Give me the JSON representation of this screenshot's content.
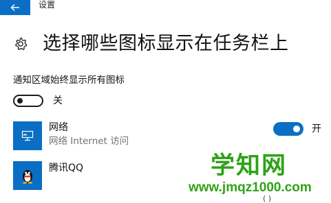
{
  "window": {
    "title": "设置"
  },
  "page": {
    "title": "选择哪些图标显示在任务栏上"
  },
  "always_show_all": {
    "label": "通知区域始终显示所有图标",
    "state_label": "关",
    "on": false
  },
  "apps": [
    {
      "name": "网络",
      "subtitle": "网络 Internet 访问",
      "icon": "network-icon",
      "toggle_on": true,
      "toggle_label": "开"
    },
    {
      "name": "腾讯QQ",
      "icon": "qq-penguin-icon"
    }
  ],
  "watermark": {
    "text": "学知网",
    "url": "www.jmqz1000.com"
  },
  "edge_glyph": "( )",
  "colors": {
    "accent": "#0a6fc4",
    "watermark": "#2da317"
  }
}
